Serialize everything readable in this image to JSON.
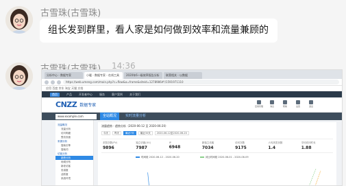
{
  "messages": [
    {
      "sender": "古雪珠(古雪珠)",
      "text": "组长发到群里，看人家是如何做到效率和流量兼顾的"
    },
    {
      "sender": "古雪珠(古雪珠)",
      "time": "14:36"
    }
  ],
  "screenshot": {
    "browser_tabs": [
      "分析中心 - 数据专家",
      "小暖 - 数据专家 - 在线工具",
      "2020年6一级效率报告分析",
      "联营相关 - 以数据"
    ],
    "url": "https://web.umeng.com/main.php?c=flow&a=frame&siteid=1278986#!/1591971110",
    "bookmarks": "应用   百度   京东   淘宝   天猫   文档",
    "top_nav": [
      "首页",
      "产品",
      "开发者中心",
      "服务",
      "客户案例",
      "关于我们"
    ],
    "logo": "CNZZ",
    "logo_subtitle": "数据专家",
    "header_icons": [
      "应用管理",
      "消息",
      "帮助",
      "设置",
      "退出"
    ],
    "site_name": "www.example.com",
    "sub_tabs": [
      "全站概况",
      "实时流量分析"
    ],
    "side_nav": [
      {
        "label": "流量概况",
        "type": "grp"
      },
      {
        "label": "流量分析",
        "type": "item"
      },
      {
        "label": "访问明细",
        "type": "item"
      },
      {
        "label": "受访页面",
        "type": "item"
      },
      {
        "label": "来源分析",
        "type": "grp"
      },
      {
        "label": "搜索引擎",
        "type": "item"
      },
      {
        "label": "搜索词",
        "type": "item"
      },
      {
        "label": "访客分析",
        "type": "grp"
      },
      {
        "label": "趋势分析",
        "type": "on"
      },
      {
        "label": "地域分布",
        "type": "item"
      },
      {
        "label": "新老访客",
        "type": "item"
      },
      {
        "label": "忠诚度",
        "type": "item"
      },
      {
        "label": "活跃度",
        "type": "item"
      },
      {
        "label": "系统环境",
        "type": "item"
      }
    ],
    "main_title": "流量趋势 - 趋势分析（2020-06-12 至 2020-06-20）",
    "filters": [
      "今天",
      "昨天",
      "最近7天",
      "最近30天",
      "2020-06-12至2020-06-20"
    ],
    "stats": [
      {
        "label": "浏览次数(PV)",
        "value": "9896"
      },
      {
        "label": "独立访客(UV)",
        "value": "7987"
      },
      {
        "label": "IP",
        "value": "6948"
      },
      {
        "label": "新独立访客",
        "value": "7034"
      },
      {
        "label": "访问次数",
        "value": "9175"
      },
      {
        "label": "人均浏览页数",
        "value": "1.4"
      },
      {
        "label": "平均访问时长",
        "value": "1.88"
      }
    ],
    "legend": [
      "时间段 2020-06-12 - 2020-06-20",
      "对比时间段 2020-06-01 - 2020-06-09"
    ],
    "colors": {
      "primary_blue": "#2f8ae5",
      "nav_dark": "#2b3a4a",
      "series_a": "#2f8ae5",
      "series_b": "#8bd08b"
    }
  }
}
